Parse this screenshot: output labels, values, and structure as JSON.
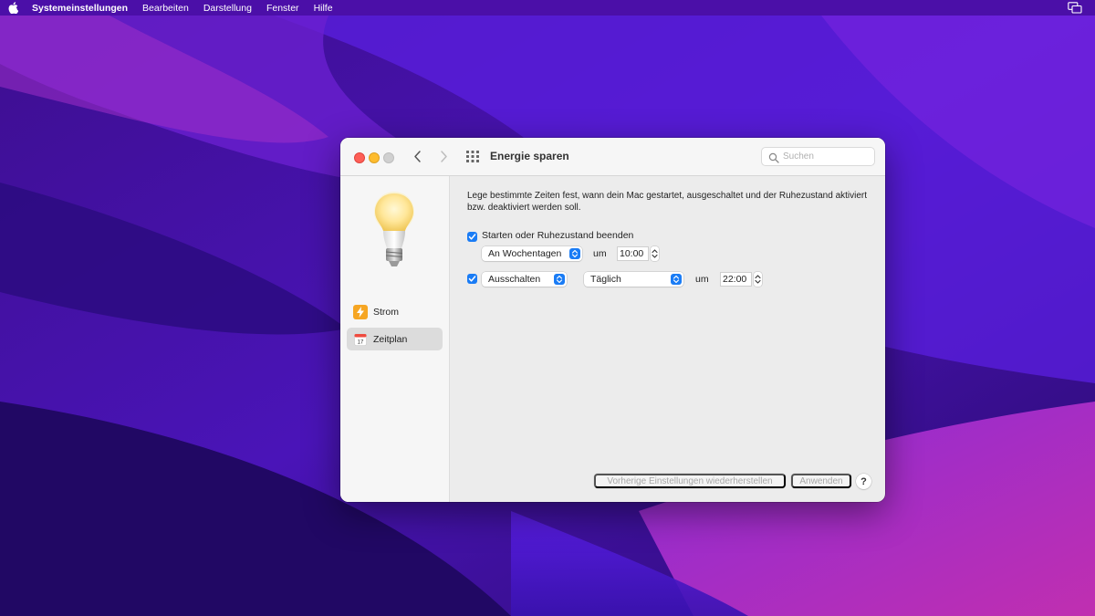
{
  "menubar": {
    "apple_icon": "apple-logo",
    "items": [
      "Systemeinstellungen",
      "Bearbeiten",
      "Darstellung",
      "Fenster",
      "Hilfe"
    ],
    "right_icon": "screen-mirroring-icon"
  },
  "window": {
    "title": "Energie sparen",
    "search": {
      "placeholder": "Suchen",
      "value": ""
    }
  },
  "sidebar": {
    "items": [
      {
        "label": "Strom",
        "icon": "lightning-bolt-icon",
        "icon_color": "#f6a623"
      },
      {
        "label": "Zeitplan",
        "icon": "calendar-icon",
        "selected": true
      }
    ]
  },
  "content": {
    "description": "Lege bestimmte Zeiten fest, wann dein Mac gestartet, ausgeschaltet und der Ruhezustand aktiviert bzw. deaktiviert werden soll.",
    "start": {
      "checked": true,
      "label": "Starten oder Ruhezustand beenden",
      "days": "An Wochentagen",
      "um": "um",
      "time": "10:00"
    },
    "off": {
      "checked": true,
      "action": "Ausschalten",
      "days": "Täglich",
      "um": "um",
      "time": "22:00"
    }
  },
  "footer": {
    "restore_label": "Vorherige Einstellungen wiederherstellen",
    "apply_label": "Anwenden",
    "help_label": "?"
  },
  "colors": {
    "accent": "#1a7cf5",
    "menubar": "#4b0fa8"
  }
}
